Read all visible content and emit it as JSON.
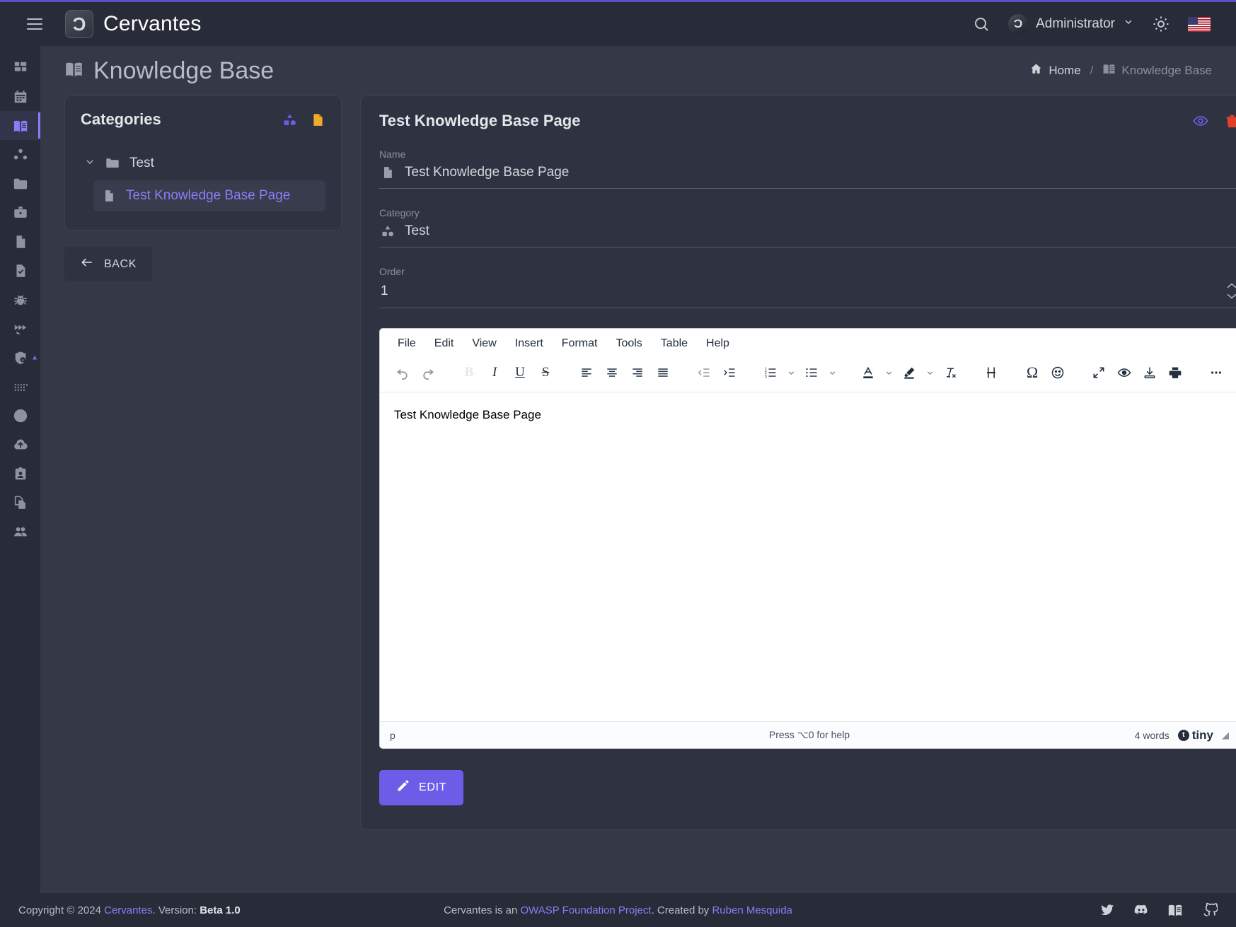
{
  "header": {
    "menu_icon": "hamburger-icon",
    "brand": "Cervantes",
    "search_icon": "search-icon",
    "user": "Administrator",
    "chevron": "chevron-down-icon",
    "theme_icon": "sun-icon",
    "language_flag": "us-flag-icon"
  },
  "sidebar": {
    "items": [
      {
        "name": "dashboard",
        "icon": "dashboard-icon",
        "active": false
      },
      {
        "name": "calendar",
        "icon": "calendar-icon",
        "active": false
      },
      {
        "name": "knowledge-base",
        "icon": "book-icon",
        "active": true
      },
      {
        "name": "organizations",
        "icon": "nodes-icon",
        "active": false
      },
      {
        "name": "projects",
        "icon": "folder-icon",
        "active": false
      },
      {
        "name": "clients",
        "icon": "briefcase-icon",
        "active": false
      },
      {
        "name": "reports",
        "icon": "file-icon",
        "active": false
      },
      {
        "name": "tasks",
        "icon": "file-check-icon",
        "active": false
      },
      {
        "name": "vulnerabilities",
        "icon": "bug-icon",
        "active": false
      },
      {
        "name": "attack-paths",
        "icon": "arrows-icon",
        "active": false
      },
      {
        "name": "assets",
        "icon": "shield-e-icon",
        "active": false
      },
      {
        "name": "grid",
        "icon": "dots-grid-icon",
        "active": false
      },
      {
        "name": "history",
        "icon": "clock-icon",
        "active": false
      },
      {
        "name": "upload",
        "icon": "cloud-upload-icon",
        "active": false
      },
      {
        "name": "identity",
        "icon": "id-card-icon",
        "active": false
      },
      {
        "name": "templates",
        "icon": "copy-file-icon",
        "active": false
      },
      {
        "name": "users",
        "icon": "users-icon",
        "active": false
      }
    ]
  },
  "page": {
    "icon": "book-icon",
    "title": "Knowledge Base",
    "breadcrumb": {
      "home_icon": "home-icon",
      "home": "Home",
      "separator": "/",
      "current_icon": "book-icon",
      "current": "Knowledge Base"
    }
  },
  "categories": {
    "title": "Categories",
    "add_category_icon": "add-category-icon",
    "add_page_icon": "add-page-icon",
    "tree": {
      "chevron": "chevron-down-icon",
      "folder_icon": "folder-icon",
      "folder_label": "Test",
      "child_icon": "document-icon",
      "child_label": "Test Knowledge Base Page"
    },
    "back_button": {
      "icon": "arrow-left-icon",
      "label": "BACK"
    }
  },
  "detail": {
    "title": "Test Knowledge Base Page",
    "view_icon": "eye-icon",
    "delete_icon": "trash-icon",
    "fields": [
      {
        "label": "Name",
        "value": "Test Knowledge Base Page",
        "icon": "document-icon"
      },
      {
        "label": "Category",
        "value": "Test",
        "icon": "category-icon"
      },
      {
        "label": "Order",
        "value": "1",
        "icon": ""
      }
    ],
    "edit_button": {
      "icon": "pencil-icon",
      "label": "EDIT"
    }
  },
  "editor": {
    "menubar": [
      "File",
      "Edit",
      "View",
      "Insert",
      "Format",
      "Tools",
      "Table",
      "Help"
    ],
    "toolbar": [
      "undo-icon",
      "redo-icon",
      "bold-icon",
      "italic-icon",
      "underline-icon",
      "strikethrough-icon",
      "align-left-icon",
      "align-center-icon",
      "align-right-icon",
      "align-justify-icon",
      "outdent-icon",
      "indent-icon",
      "numbered-list-icon",
      "bullet-list-icon",
      "text-color-icon",
      "highlight-color-icon",
      "clear-format-icon",
      "page-break-icon",
      "special-character-icon",
      "emoji-icon",
      "fullscreen-icon",
      "preview-icon",
      "export-icon",
      "print-icon",
      "more-icon"
    ],
    "content": "Test Knowledge Base Page",
    "status": {
      "path": "p",
      "help": "Press ⌥0 for help",
      "words": "4 words",
      "brand": "tiny",
      "resize_icon": "resize-handle-icon"
    }
  },
  "footer": {
    "copyright_prefix": "Copyright © 2024 ",
    "brand": "Cervantes",
    "version_prefix": ". Version: ",
    "version": "Beta 1.0",
    "mid_prefix": "Cervantes is an ",
    "owasp": "OWASP Foundation Project",
    "mid_middle": ". Created by ",
    "author": "Ruben Mesquida",
    "socials": [
      "twitter-icon",
      "discord-icon",
      "docs-icon",
      "github-icon"
    ]
  }
}
